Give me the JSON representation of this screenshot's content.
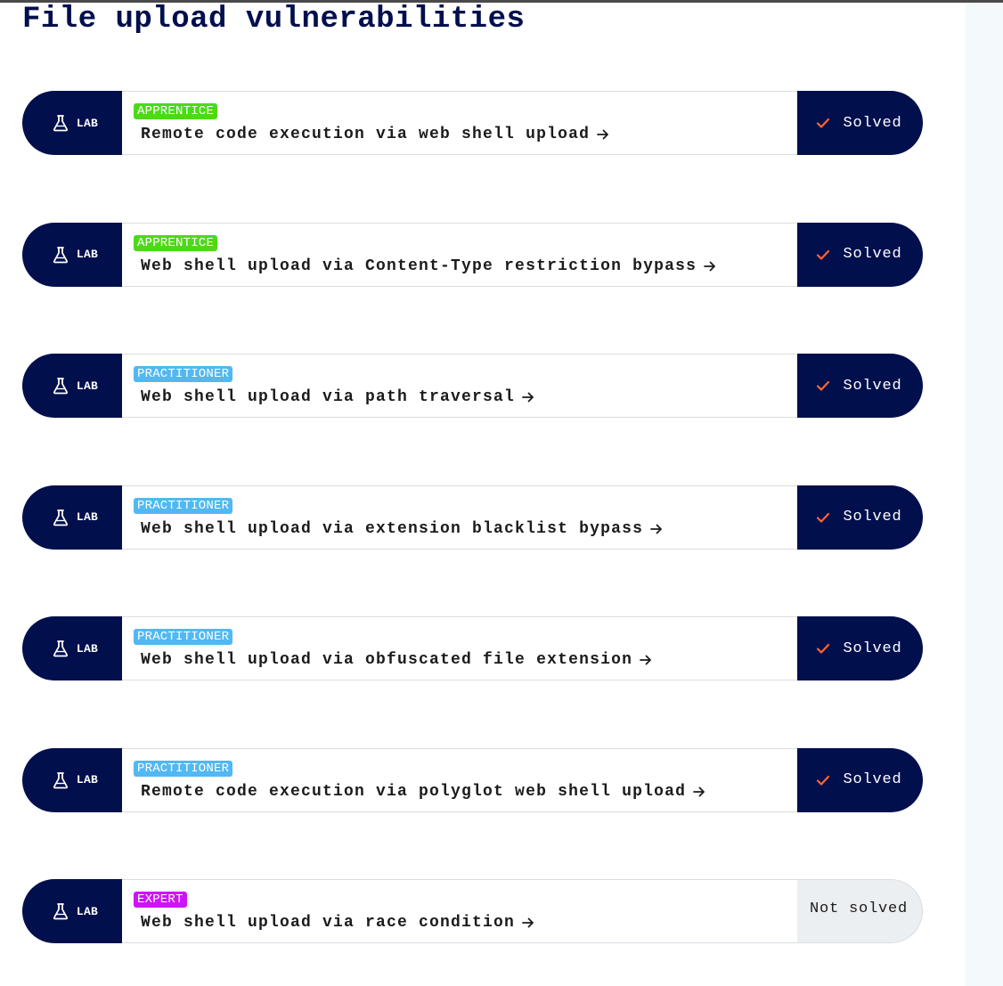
{
  "page": {
    "title": "File upload vulnerabilities"
  },
  "colors": {
    "navy": "#010f4d",
    "apprentice": "#4dd919",
    "practitioner": "#52b8f2",
    "expert": "#cc14f7",
    "check": "#ff6633"
  },
  "lab_tag_label": "LAB",
  "labs": [
    {
      "level": "APPRENTICE",
      "level_color": "#4dd919",
      "title": "Remote code execution via web shell upload",
      "status": "Solved",
      "solved": true
    },
    {
      "level": "APPRENTICE",
      "level_color": "#4dd919",
      "title": "Web shell upload via Content-Type restriction bypass",
      "status": "Solved",
      "solved": true
    },
    {
      "level": "PRACTITIONER",
      "level_color": "#52b8f2",
      "title": "Web shell upload via path traversal",
      "status": "Solved",
      "solved": true
    },
    {
      "level": "PRACTITIONER",
      "level_color": "#52b8f2",
      "title": "Web shell upload via extension blacklist bypass",
      "status": "Solved",
      "solved": true
    },
    {
      "level": "PRACTITIONER",
      "level_color": "#52b8f2",
      "title": "Web shell upload via obfuscated file extension",
      "status": "Solved",
      "solved": true
    },
    {
      "level": "PRACTITIONER",
      "level_color": "#52b8f2",
      "title": "Remote code execution via polyglot web shell upload",
      "status": "Solved",
      "solved": true
    },
    {
      "level": "EXPERT",
      "level_color": "#cc14f7",
      "title": "Web shell upload via race condition",
      "status": "Not solved",
      "solved": false
    }
  ]
}
